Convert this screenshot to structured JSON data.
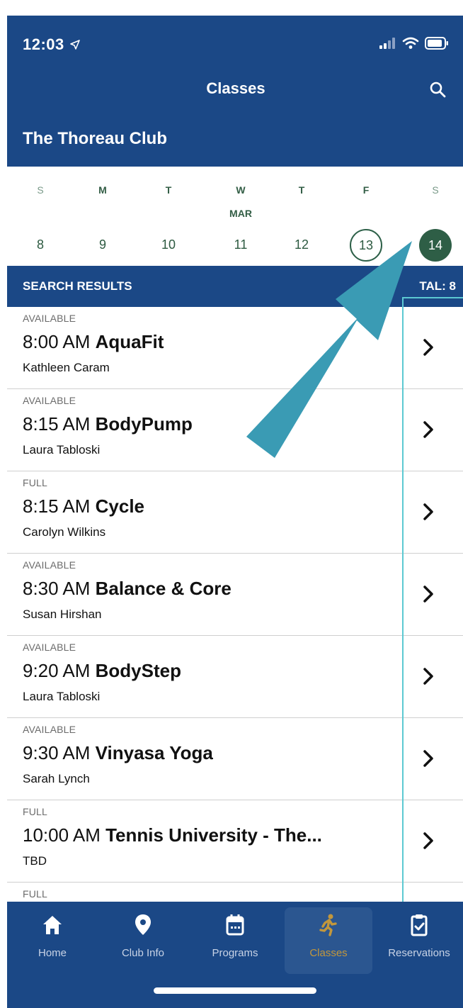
{
  "status_bar": {
    "time": "12:03"
  },
  "header": {
    "title": "Classes",
    "club_name": "The Thoreau Club"
  },
  "calendar": {
    "days": [
      {
        "dow": "S",
        "date": "8",
        "state": "normal",
        "weekend": true
      },
      {
        "dow": "M",
        "date": "9",
        "state": "normal",
        "weekend": false
      },
      {
        "dow": "T",
        "date": "10",
        "state": "normal",
        "weekend": false
      },
      {
        "dow": "W",
        "date": "11",
        "state": "normal",
        "weekend": false
      },
      {
        "dow": "T",
        "date": "12",
        "state": "normal",
        "weekend": false
      },
      {
        "dow": "F",
        "date": "13",
        "state": "today",
        "weekend": false
      },
      {
        "dow": "S",
        "date": "14",
        "state": "selected",
        "weekend": true
      }
    ],
    "month": "MAR"
  },
  "results": {
    "label": "SEARCH RESULTS",
    "total": "TAL: 8"
  },
  "classes": [
    {
      "status": "AVAILABLE",
      "time": "8:00 AM",
      "name": "AquaFit",
      "instructor": "Kathleen Caram"
    },
    {
      "status": "AVAILABLE",
      "time": "8:15 AM",
      "name": "BodyPump",
      "instructor": "Laura Tabloski"
    },
    {
      "status": "FULL",
      "time": "8:15 AM",
      "name": "Cycle",
      "instructor": "Carolyn Wilkins"
    },
    {
      "status": "AVAILABLE",
      "time": "8:30 AM",
      "name": "Balance & Core",
      "instructor": "Susan Hirshan"
    },
    {
      "status": "AVAILABLE",
      "time": "9:20 AM",
      "name": "BodyStep",
      "instructor": "Laura Tabloski"
    },
    {
      "status": "AVAILABLE",
      "time": "9:30 AM",
      "name": "Vinyasa Yoga",
      "instructor": "Sarah Lynch"
    },
    {
      "status": "FULL",
      "time": "10:00 AM",
      "name": "Tennis University - The...",
      "instructor": "TBD"
    },
    {
      "status": "FULL",
      "time": "",
      "name": "",
      "instructor": ""
    }
  ],
  "tabs": [
    {
      "label": "Home",
      "icon": "home-icon",
      "active": false
    },
    {
      "label": "Club Info",
      "icon": "location-pin-icon",
      "active": false
    },
    {
      "label": "Programs",
      "icon": "calendar-icon",
      "active": false
    },
    {
      "label": "Classes",
      "icon": "runner-icon",
      "active": true
    },
    {
      "label": "Reservations",
      "icon": "clipboard-check-icon",
      "active": false
    }
  ],
  "colors": {
    "primary": "#1b4886",
    "accent_green": "#2e5e46",
    "active_tab": "#c2973c",
    "annotation": "#3a9bb4"
  }
}
